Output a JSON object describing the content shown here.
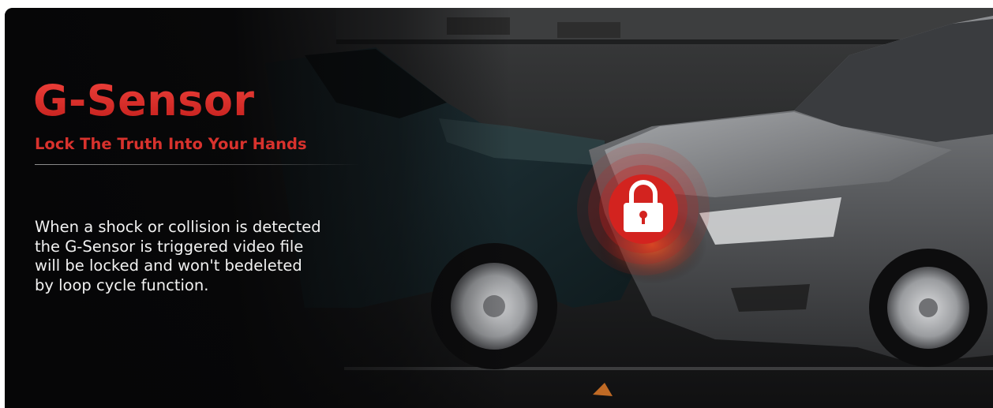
{
  "banner": {
    "title": "G-Sensor",
    "subtitle": "Lock The Truth Into Your Hands",
    "description_lines": [
      "When a shock or collision is detected",
      "the G-Sensor is triggered video file",
      "will be locked and won't bedeleted",
      "by loop cycle function."
    ]
  },
  "icons": {
    "lock": "lock-icon"
  },
  "colors": {
    "accent_red": "#d42a26",
    "background": "#0b0b0c",
    "text": "#f2f2f2"
  }
}
